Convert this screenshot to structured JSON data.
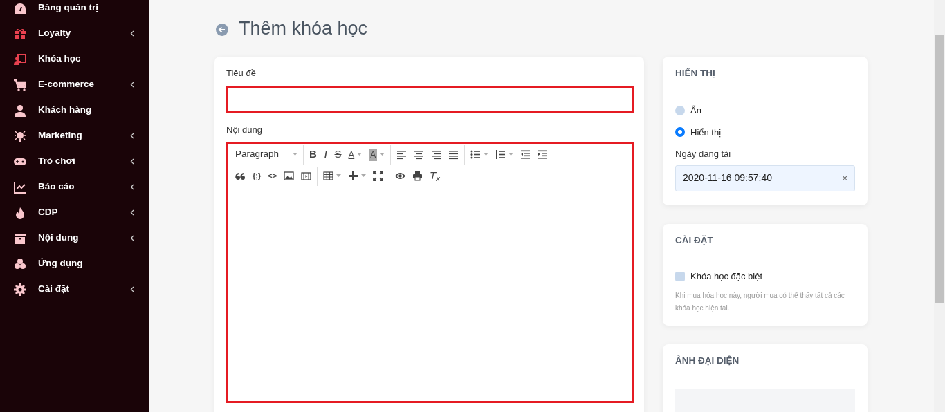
{
  "sidebar": {
    "items": [
      {
        "label": "Bảng quản trị",
        "expandable": false
      },
      {
        "label": "Loyalty",
        "expandable": true
      },
      {
        "label": "Khóa học",
        "expandable": false
      },
      {
        "label": "E-commerce",
        "expandable": true
      },
      {
        "label": "Khách hàng",
        "expandable": false
      },
      {
        "label": "Marketing",
        "expandable": true
      },
      {
        "label": "Trò chơi",
        "expandable": true
      },
      {
        "label": "Báo cáo",
        "expandable": true
      },
      {
        "label": "CDP",
        "expandable": true
      },
      {
        "label": "Nội dung",
        "expandable": true
      },
      {
        "label": "Ứng dụng",
        "expandable": false
      },
      {
        "label": "Cài đặt",
        "expandable": true
      }
    ]
  },
  "page": {
    "title": "Thêm khóa học"
  },
  "form": {
    "title_label": "Tiêu đề",
    "content_label": "Nội dung",
    "toolbar": [
      [
        {
          "kind": "format",
          "label": "Paragraph",
          "dropdown": true
        }
      ],
      [
        {
          "kind": "bold",
          "label": "B",
          "dropdown": false
        },
        {
          "kind": "italic",
          "label": "I",
          "dropdown": false
        },
        {
          "kind": "strike",
          "label": "S",
          "dropdown": false
        },
        {
          "kind": "color",
          "label": "A",
          "dropdown": true
        },
        {
          "kind": "highlight",
          "label": "A",
          "dropdown": true
        }
      ],
      [
        {
          "kind": "align-left",
          "dropdown": false
        },
        {
          "kind": "align-center",
          "dropdown": false
        },
        {
          "kind": "align-right",
          "dropdown": false
        },
        {
          "kind": "justify",
          "dropdown": false
        }
      ],
      [
        {
          "kind": "bullets",
          "dropdown": true
        },
        {
          "kind": "numbers",
          "dropdown": true
        },
        {
          "kind": "outdent",
          "dropdown": false
        },
        {
          "kind": "indent",
          "dropdown": false
        }
      ],
      [
        {
          "kind": "quote",
          "dropdown": false
        },
        {
          "kind": "code",
          "label": "{;}",
          "dropdown": false
        },
        {
          "kind": "code",
          "label": "<>",
          "dropdown": false
        },
        {
          "kind": "image",
          "dropdown": false
        },
        {
          "kind": "video",
          "dropdown": false
        }
      ],
      [
        {
          "kind": "table",
          "dropdown": true
        },
        {
          "kind": "plus",
          "dropdown": true
        },
        {
          "kind": "fullscreen",
          "dropdown": false
        }
      ],
      [
        {
          "kind": "preview",
          "dropdown": false
        },
        {
          "kind": "print",
          "dropdown": false
        },
        {
          "kind": "clear",
          "label": "T$_{x}$",
          "dropdown": false
        }
      ]
    ]
  },
  "display": {
    "heading": "HIỂN THỊ",
    "options": [
      {
        "label": "Ẩn",
        "selected": false
      },
      {
        "label": "Hiển thị",
        "selected": true
      }
    ],
    "date_label": "Ngày đăng tải",
    "date_value": "2020-11-16 09:57:40",
    "clear": "×"
  },
  "settings": {
    "heading": "CÀI ĐẶT",
    "checkbox": {
      "label": "Khóa học đặc biệt",
      "checked": false
    },
    "help": "Khi mua hóa học này, người mua có thể thấy tất cả các khóa học hiện tại."
  },
  "avatar": {
    "heading": "ẢNH ĐẠI DIỆN"
  }
}
